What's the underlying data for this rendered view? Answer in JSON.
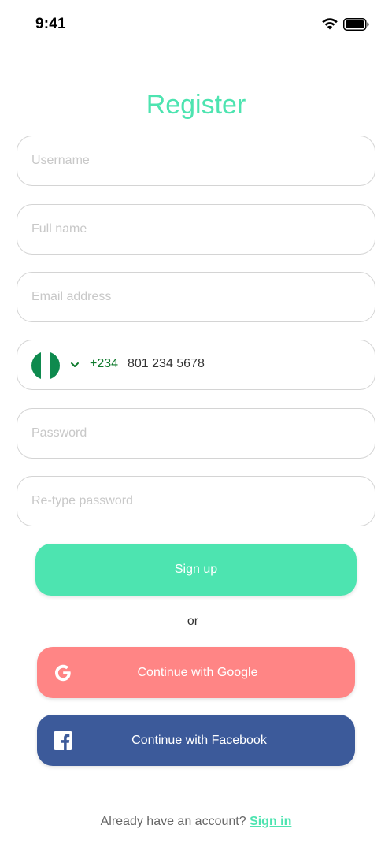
{
  "status_bar": {
    "time": "9:41",
    "icons": [
      "wifi-icon",
      "battery-icon"
    ]
  },
  "title": "Register",
  "fields": {
    "username": {
      "placeholder": "Username",
      "value": ""
    },
    "full_name": {
      "placeholder": "Full name",
      "value": ""
    },
    "email": {
      "placeholder": "Email address",
      "value": ""
    },
    "phone": {
      "country_flag": "nigeria-flag-icon",
      "dial_code": "+234",
      "number": "801 234 5678"
    },
    "password": {
      "placeholder": "Password",
      "value": ""
    },
    "retype_password": {
      "placeholder": "Re-type password",
      "value": ""
    }
  },
  "buttons": {
    "signup_label": "Sign up",
    "or_label": "or",
    "google_label": "Continue with Google",
    "facebook_label": "Continue with Facebook"
  },
  "footer": {
    "prompt": "Already have an account?",
    "signin_label": "Sign in"
  },
  "colors": {
    "accent": "#4de4b0",
    "google": "#ff8585",
    "facebook": "#3c5a9a",
    "flag_green": "#0e8a4e"
  }
}
